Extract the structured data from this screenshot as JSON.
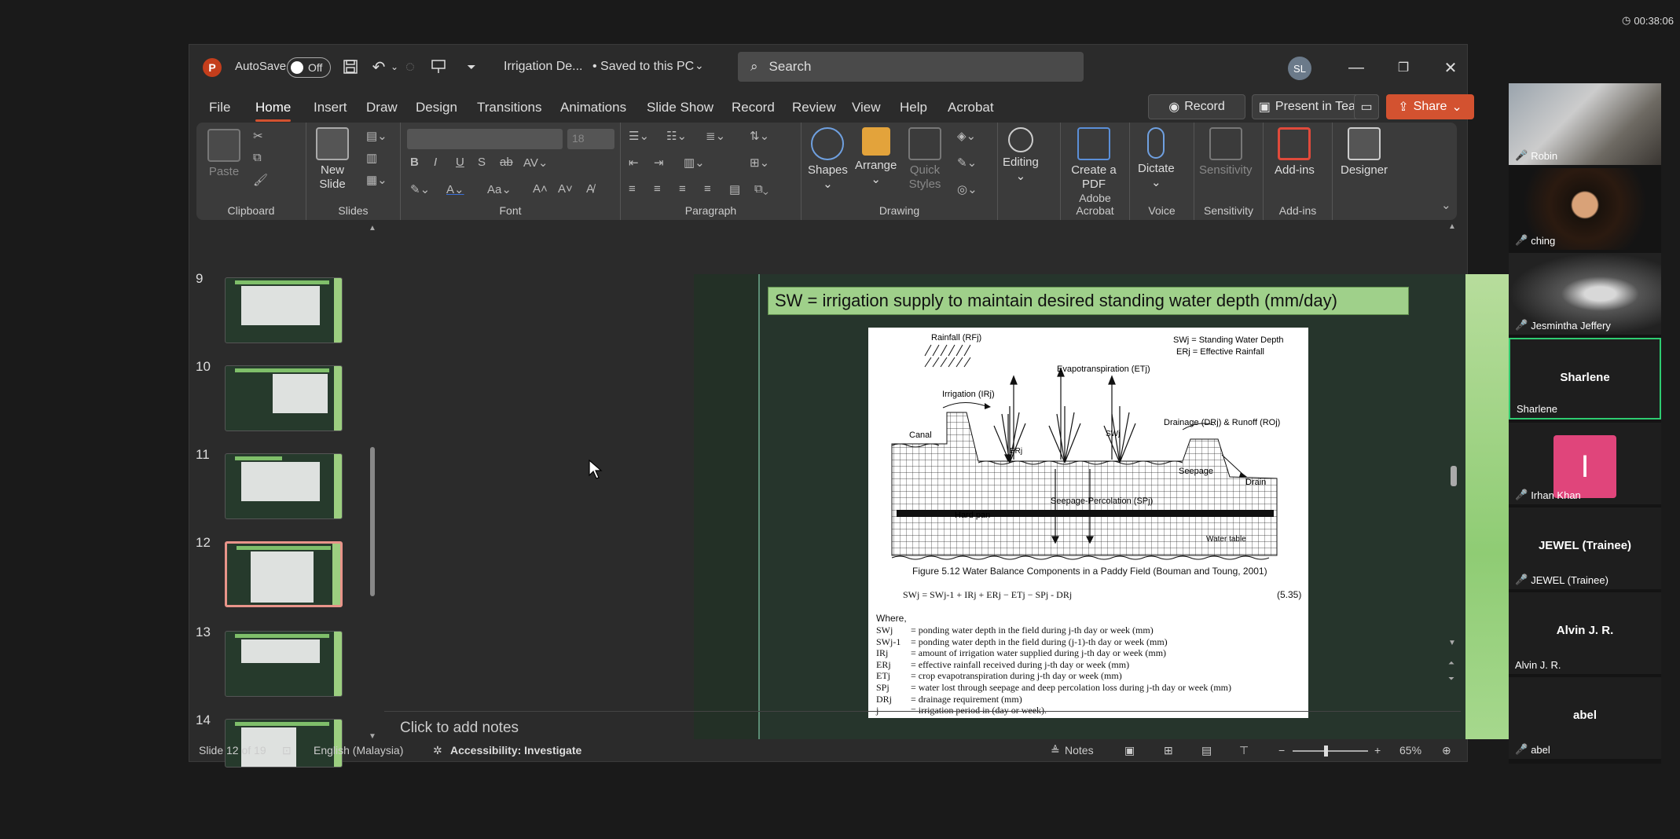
{
  "meeting": {
    "timer": "00:38:06"
  },
  "titlebar": {
    "autosave_label": "AutoSave",
    "autosave_state": "Off",
    "doc_title": "Irrigation De...",
    "saved_status": "• Saved to this PC",
    "search_placeholder": "Search",
    "user_initials": "SL"
  },
  "menu": [
    "File",
    "Home",
    "Insert",
    "Draw",
    "Design",
    "Transitions",
    "Animations",
    "Slide Show",
    "Record",
    "Review",
    "View",
    "Help",
    "Acrobat"
  ],
  "menu_active": "Home",
  "actions": {
    "record": "Record",
    "present": "Present in Teams",
    "share": "Share"
  },
  "ribbon": {
    "clipboard": {
      "paste": "Paste",
      "label": "Clipboard"
    },
    "slides": {
      "new_slide": "New Slide",
      "label": "Slides"
    },
    "font": {
      "label": "Font",
      "size": "18"
    },
    "paragraph": {
      "label": "Paragraph"
    },
    "drawing": {
      "shapes": "Shapes",
      "arrange": "Arrange",
      "quick_styles": "Quick Styles",
      "label": "Drawing"
    },
    "editing": {
      "editing": "Editing"
    },
    "acrobat": {
      "create_pdf": "Create a PDF",
      "label": "Adobe Acrobat"
    },
    "voice": {
      "dictate": "Dictate",
      "label": "Voice"
    },
    "sensitivity": {
      "sensitivity": "Sensitivity",
      "label": "Sensitivity"
    },
    "addins": {
      "addins": "Add-ins",
      "label": "Add-ins"
    },
    "designer": {
      "designer": "Designer"
    }
  },
  "thumbnails": [
    {
      "num": "9"
    },
    {
      "num": "10"
    },
    {
      "num": "11"
    },
    {
      "num": "12"
    },
    {
      "num": "13"
    },
    {
      "num": "14"
    }
  ],
  "slide": {
    "title": "SW = irrigation supply to maintain desired standing water depth (mm/day)",
    "figure": {
      "legend1": "SWj = Standing Water Depth",
      "legend2": "ERj = Effective Rainfall",
      "rainfall": "Rainfall (RFj)",
      "evapo": "Evapotranspiration (ETj)",
      "irrigation": "Irrigation (IRj)",
      "canal": "Canal",
      "drainage": "Drainage (DRj) & Runoff (ROj)",
      "erj": "ERj",
      "swj": "SWj",
      "seepage": "Seepage",
      "drain": "Drain",
      "hardpan": "Hard pan",
      "seepperc": "Seepage-Percolation (SPj)",
      "watertable": "Water table",
      "caption": "Figure 5.12 Water Balance Components in a Paddy Field (Bouman and Toung, 2001)",
      "equation": "SWj = SWj-1 + IRj + ERj − ETj − SPj - DRj",
      "eq_num": "(5.35)",
      "where": "Where,",
      "defs": [
        {
          "sym": "SWj",
          "def": "= ponding water depth in the field during j-th day or week (mm)"
        },
        {
          "sym": "SWj-1",
          "def": "= ponding water depth in the field during (j-1)-th day or week (mm)"
        },
        {
          "sym": "IRj",
          "def": "= amount of irrigation water supplied during j-th day or week (mm)"
        },
        {
          "sym": "ERj",
          "def": "= effective rainfall received during j-th day or week (mm)"
        },
        {
          "sym": "ETj",
          "def": "= crop evapotranspiration during j-th day or week (mm)"
        },
        {
          "sym": "SPj",
          "def": "= water lost through seepage and deep percolation loss during j-th day or week (mm)"
        },
        {
          "sym": "DRj",
          "def": "= drainage requirement (mm)"
        },
        {
          "sym": "j",
          "def": "= irrigation period in (day or week)."
        }
      ]
    }
  },
  "notes_placeholder": "Click to add notes",
  "status": {
    "slide": "Slide 12 of 19",
    "language": "English (Malaysia)",
    "accessibility": "Accessibility: Investigate",
    "notes": "Notes",
    "zoom": "65%"
  },
  "participants": [
    {
      "name": "Robin",
      "muted": true,
      "video": true
    },
    {
      "name": "ching",
      "muted": true,
      "video": true
    },
    {
      "name": "Jesmintha Jeffery",
      "muted": true,
      "video": true
    },
    {
      "name": "Sharlene",
      "muted": false,
      "video": false,
      "center": "Sharlene",
      "active": true
    },
    {
      "name": "Irhan Khan",
      "muted": true,
      "video": false,
      "initial": "I"
    },
    {
      "name": "JEWEL (Trainee)",
      "muted": true,
      "video": false,
      "center": "JEWEL (Trainee)"
    },
    {
      "name": "Alvin J. R.",
      "muted": false,
      "video": false,
      "center": "Alvin J. R."
    },
    {
      "name": "abel",
      "muted": true,
      "video": false,
      "center": "abel"
    }
  ],
  "colors": {
    "accent": "#d35230",
    "slide_title_bg": "#9fd08a",
    "active_speaker": "#2ecc71",
    "irhan_avatar": "#e0457b"
  }
}
